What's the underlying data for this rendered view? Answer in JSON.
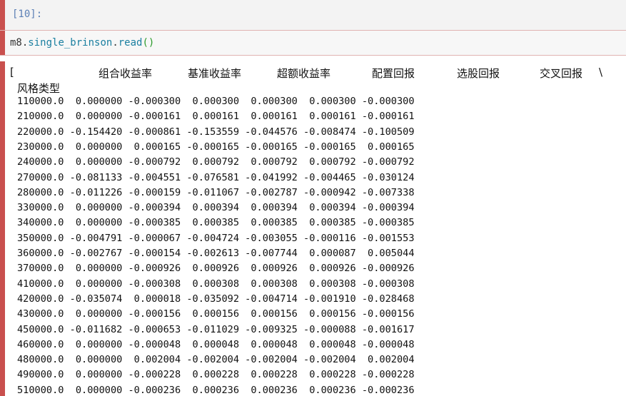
{
  "prompt_label": "[10]:",
  "code": {
    "obj": "m8",
    "dot1": ".",
    "attr1": "single_brinson",
    "dot2": ".",
    "attr2": "read",
    "parens": "()"
  },
  "output": {
    "open_bracket": "[",
    "columns": [
      "组合收益率",
      "基准收益率",
      "超额收益率",
      "配置回报",
      "选股回报",
      "交叉回报"
    ],
    "continuation": "\\",
    "index_name": "风格类型",
    "rows": [
      "110000.0  0.000000 -0.000300  0.000300  0.000300  0.000300 -0.000300",
      "210000.0  0.000000 -0.000161  0.000161  0.000161  0.000161 -0.000161",
      "220000.0 -0.154420 -0.000861 -0.153559 -0.044576 -0.008474 -0.100509",
      "230000.0  0.000000  0.000165 -0.000165 -0.000165 -0.000165  0.000165",
      "240000.0  0.000000 -0.000792  0.000792  0.000792  0.000792 -0.000792",
      "270000.0 -0.081133 -0.004551 -0.076581 -0.041992 -0.004465 -0.030124",
      "280000.0 -0.011226 -0.000159 -0.011067 -0.002787 -0.000942 -0.007338",
      "330000.0  0.000000 -0.000394  0.000394  0.000394  0.000394 -0.000394",
      "340000.0  0.000000 -0.000385  0.000385  0.000385  0.000385 -0.000385",
      "350000.0 -0.004791 -0.000067 -0.004724 -0.003055 -0.000116 -0.001553",
      "360000.0 -0.002767 -0.000154 -0.002613 -0.007744  0.000087  0.005044",
      "370000.0  0.000000 -0.000926  0.000926  0.000926  0.000926 -0.000926",
      "410000.0  0.000000 -0.000308  0.000308  0.000308  0.000308 -0.000308",
      "420000.0 -0.035074  0.000018 -0.035092 -0.004714 -0.001910 -0.028468",
      "430000.0  0.000000 -0.000156  0.000156  0.000156  0.000156 -0.000156",
      "450000.0 -0.011682 -0.000653 -0.011029 -0.009325 -0.000088 -0.001617",
      "460000.0  0.000000 -0.000048  0.000048  0.000048  0.000048 -0.000048",
      "480000.0  0.000000  0.002004 -0.002004 -0.002004 -0.002004  0.002004",
      "490000.0  0.000000 -0.000228  0.000228  0.000228  0.000228 -0.000228",
      "510000.0  0.000000 -0.000236  0.000236  0.000236  0.000236 -0.000236"
    ]
  }
}
